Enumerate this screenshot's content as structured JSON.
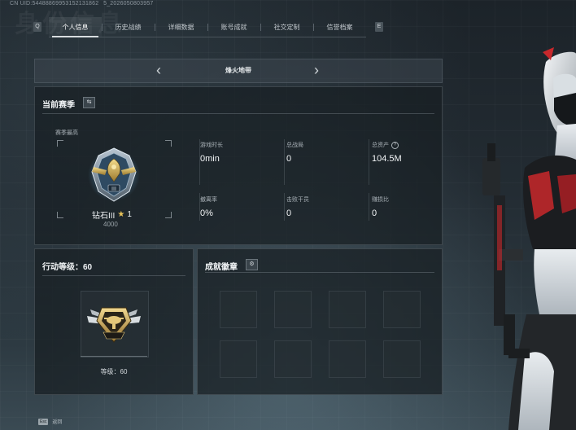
{
  "header": {
    "uid_text": "CN UID:544888699531521318625_2026050803957",
    "bg_title": "身份信息"
  },
  "tabs": [
    {
      "label": "个人信息",
      "active": true
    },
    {
      "label": "历史战绩",
      "active": false
    },
    {
      "label": "详细数据",
      "active": false
    },
    {
      "label": "账号成就",
      "active": false
    },
    {
      "label": "社交定制",
      "active": false
    },
    {
      "label": "信誉档案",
      "active": false
    }
  ],
  "tab_nav": {
    "prev_key": "Q",
    "next_key": "E"
  },
  "map_selector": {
    "name": "烽火地带",
    "prev_icon": "‹",
    "next_icon": "›"
  },
  "season": {
    "title": "当前赛季",
    "swap_icon": "⇆",
    "best_label": "赛季最高",
    "rank_name": "钻石III",
    "rank_star_icon": "★",
    "rank_stars": "1",
    "rank_score": "4000",
    "stats": [
      {
        "label": "游戏时长",
        "value": "0min"
      },
      {
        "label": "总战局",
        "value": "0"
      },
      {
        "label": "总资产",
        "value": "104.5M",
        "help": "?"
      },
      {
        "label": "撤离率",
        "value": "0%"
      },
      {
        "label": "击败干员",
        "value": "0"
      },
      {
        "label": "赚损比",
        "value": "0"
      }
    ]
  },
  "level": {
    "title": "行动等级：60",
    "label": "等级：60"
  },
  "badges": {
    "title": "成就徽章",
    "settings_icon": "⚙",
    "slot_count": 8
  },
  "footer": {
    "esc_key": "Esc",
    "esc_label": "返回"
  },
  "colors": {
    "accent_gold": "#e8c35a",
    "panel_bg": "#181e23",
    "character_red": "#c8282c"
  }
}
